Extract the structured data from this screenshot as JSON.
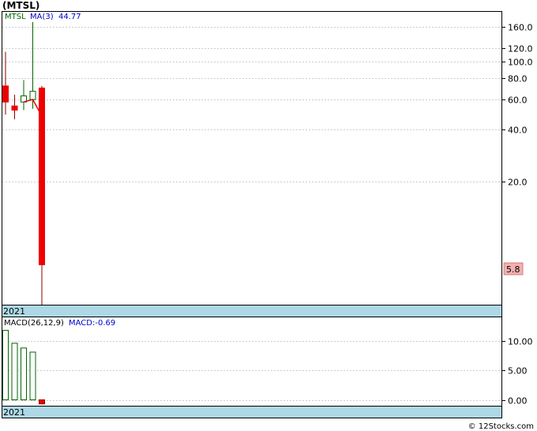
{
  "title": "(MTSL)",
  "credit": "© 12Stocks.com",
  "colors": {
    "up": "#006400",
    "down": "#ee0000",
    "ma": "#ee0000",
    "macd_bar": "#006400",
    "year_band": "#add8e6",
    "grid": "#999999",
    "label_blue": "#0000cc",
    "price_tag": "#f4b0b0"
  },
  "chart_data": [
    {
      "type": "candlestick",
      "legend": {
        "symbol": "MTSL",
        "ma_label": "MA(3)",
        "ma_value": "44.77"
      },
      "scale": "log",
      "ylim": [
        3.8,
        195
      ],
      "y_ticks": [
        "160.0",
        "120.0",
        "100.0",
        "80.0",
        "60.0",
        "40.0",
        "20.0"
      ],
      "y_tick_values": [
        160,
        120,
        100,
        80,
        60,
        40,
        20
      ],
      "x_label": "2021",
      "last_price_label": "5.8",
      "last_price": 5.8,
      "candles": [
        {
          "open": 72,
          "high": 114,
          "low": 49,
          "close": 58
        },
        {
          "open": 55,
          "high": 64,
          "low": 46,
          "close": 52
        },
        {
          "open": 58,
          "high": 78,
          "low": 52,
          "close": 63
        },
        {
          "open": 60,
          "high": 170,
          "low": 53,
          "close": 67
        },
        {
          "open": 70,
          "high": 72,
          "low": 3.8,
          "close": 6.5
        }
      ],
      "ma": [
        null,
        null,
        58,
        60,
        48
      ]
    },
    {
      "type": "bar",
      "label": "MACD(26,12,9)",
      "value_label": "MACD:-0.69",
      "ylim": [
        -1,
        14
      ],
      "y_ticks": [
        "10.00",
        "5.00",
        "0.00"
      ],
      "y_tick_values": [
        10,
        5,
        0
      ],
      "x_label": "2021",
      "values": [
        11.8,
        9.6,
        8.8,
        8.1,
        -0.69
      ]
    }
  ]
}
